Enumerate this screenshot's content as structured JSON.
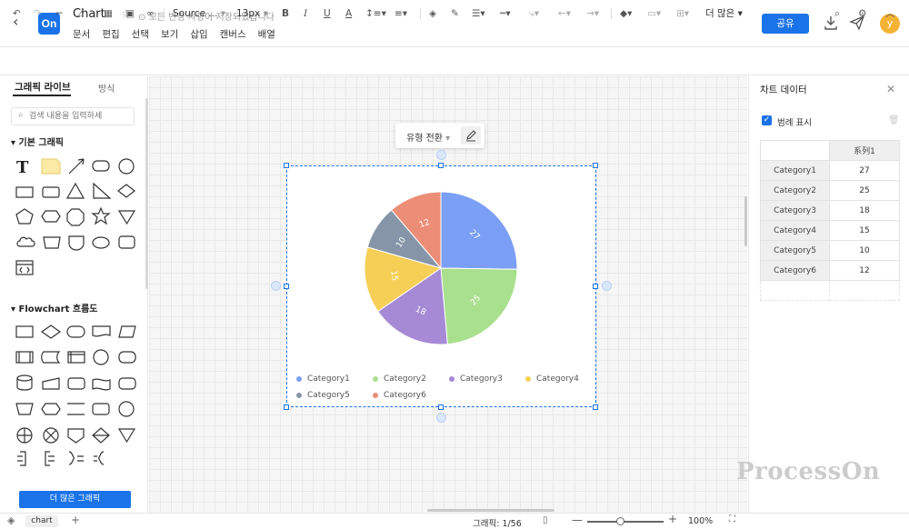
{
  "header": {
    "title": "Chart",
    "save_status": "모든 변경 사항이 저장되었습니다",
    "logo": "On",
    "menu": [
      "문서",
      "편집",
      "선택",
      "보기",
      "삽입",
      "캔버스",
      "배열"
    ],
    "share_label": "공유",
    "avatar_letter": "y"
  },
  "toolbar": {
    "font_name": "Source ...",
    "font_size": "13px",
    "more_label": "더 많은"
  },
  "left_panel": {
    "tabs": [
      "그래픽 라이브",
      "방식"
    ],
    "search_placeholder": "검색 내용을 입력하세",
    "section_basic": "기본 그래픽",
    "section_flowchart": "Flowchart 흐름도",
    "more_button": "더 많은 그래픽"
  },
  "canvas": {
    "type_switch_label": "유형 전환"
  },
  "chart_data": {
    "type": "pie",
    "categories": [
      "Category1",
      "Category2",
      "Category3",
      "Category4",
      "Category5",
      "Category6"
    ],
    "series": [
      {
        "name": "系列1",
        "values": [
          27,
          25,
          18,
          15,
          10,
          12
        ]
      }
    ],
    "colors": [
      "#7b9ff5",
      "#a9e08e",
      "#a68ad6",
      "#f6cf56",
      "#8696a8",
      "#ec8e77"
    ],
    "legend": "bottom",
    "data_labels": true
  },
  "right_panel": {
    "title": "차트 데이터",
    "legend_toggle_label": "범례 표시",
    "legend_checked": true,
    "column_header": "系列1"
  },
  "status_bar": {
    "page_tab": "chart",
    "shape_count": "그래픽: 1/56",
    "zoom": "100%"
  },
  "watermark": "ProcessOn"
}
